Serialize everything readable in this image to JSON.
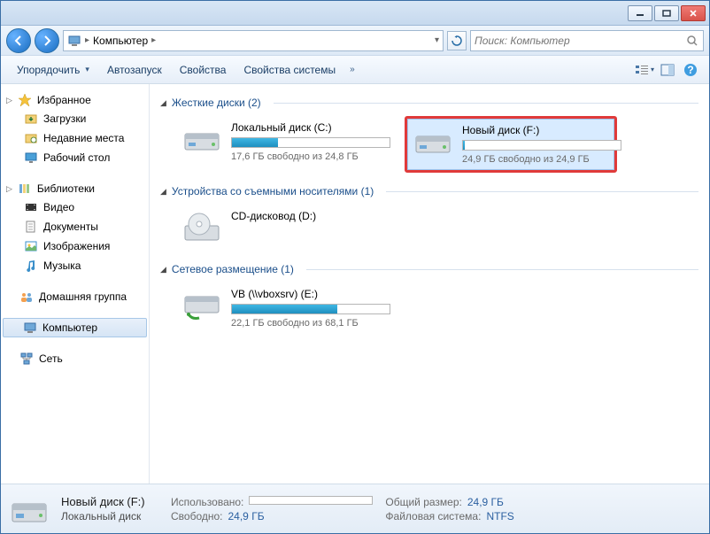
{
  "breadcrumb": {
    "location": "Компьютер"
  },
  "search": {
    "placeholder": "Поиск: Компьютер"
  },
  "toolbar": {
    "organize": "Упорядочить",
    "autorun": "Автозапуск",
    "properties": "Свойства",
    "system_properties": "Свойства системы"
  },
  "sidebar": {
    "favorites": {
      "label": "Избранное",
      "items": [
        {
          "label": "Загрузки"
        },
        {
          "label": "Недавние места"
        },
        {
          "label": "Рабочий стол"
        }
      ]
    },
    "libraries": {
      "label": "Библиотеки",
      "items": [
        {
          "label": "Видео"
        },
        {
          "label": "Документы"
        },
        {
          "label": "Изображения"
        },
        {
          "label": "Музыка"
        }
      ]
    },
    "homegroup": {
      "label": "Домашняя группа"
    },
    "computer": {
      "label": "Компьютер"
    },
    "network": {
      "label": "Сеть"
    }
  },
  "sections": {
    "hdd": {
      "title": "Жесткие диски (2)",
      "drives": [
        {
          "name": "Локальный диск (C:)",
          "free_text": "17,6 ГБ свободно из 24,8 ГБ",
          "fill_pct": 29
        },
        {
          "name": "Новый диск (F:)",
          "free_text": "24,9 ГБ свободно из 24,9 ГБ",
          "fill_pct": 1,
          "highlight": true
        }
      ]
    },
    "removable": {
      "title": "Устройства со съемными носителями (1)",
      "drives": [
        {
          "name": "CD-дисковод (D:)"
        }
      ]
    },
    "network": {
      "title": "Сетевое размещение (1)",
      "drives": [
        {
          "name": "VB (\\\\vboxsrv) (E:)",
          "free_text": "22,1 ГБ свободно из 68,1 ГБ",
          "fill_pct": 67
        }
      ]
    }
  },
  "details": {
    "name": "Новый диск (F:)",
    "type": "Локальный диск",
    "used_label": "Использовано:",
    "free_label": "Свободно:",
    "free_value": "24,9 ГБ",
    "total_label": "Общий размер:",
    "total_value": "24,9 ГБ",
    "fs_label": "Файловая система:",
    "fs_value": "NTFS"
  }
}
